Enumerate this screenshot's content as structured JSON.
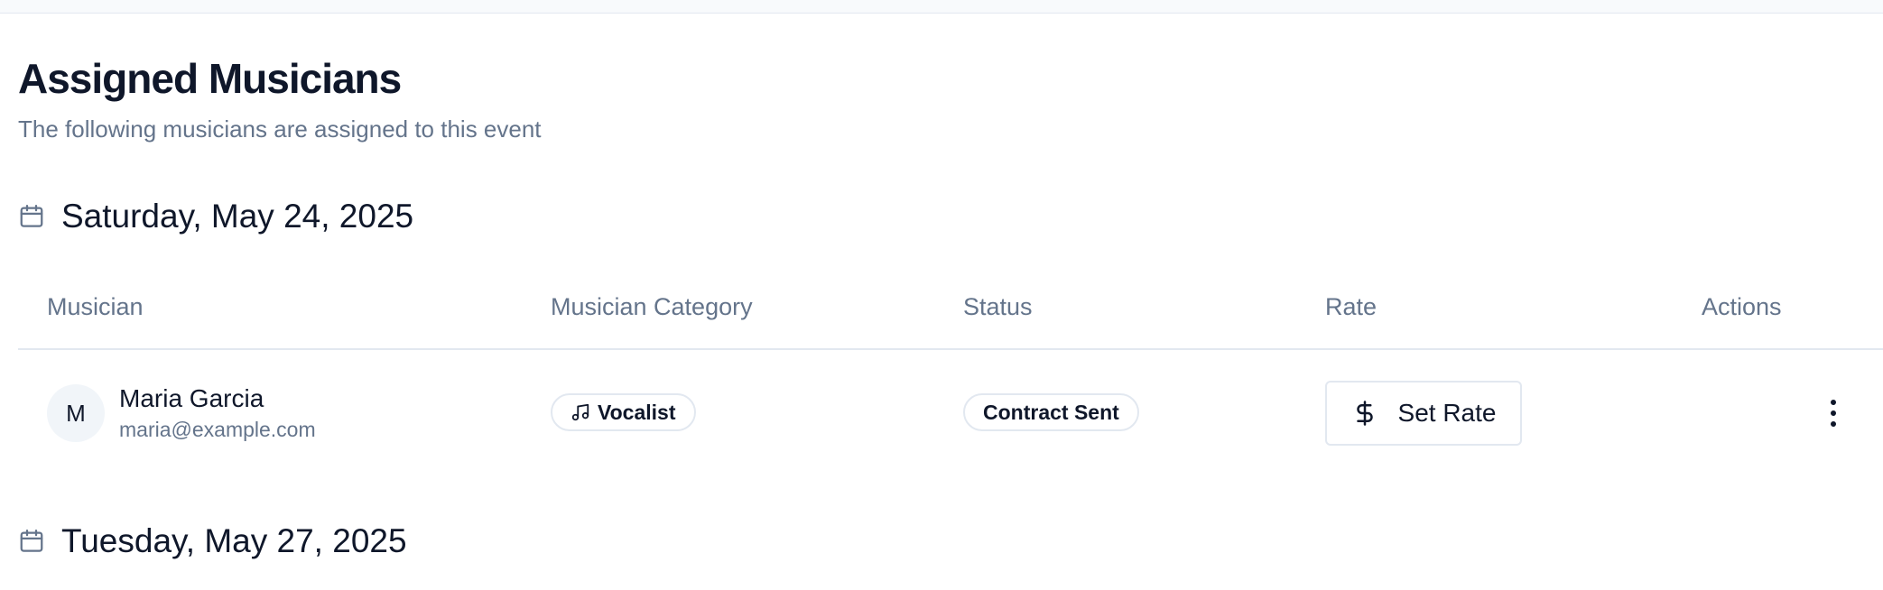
{
  "header": {
    "title": "Assigned Musicians",
    "subtitle": "The following musicians are assigned to this event"
  },
  "table": {
    "columns": [
      "Musician",
      "Musician Category",
      "Status",
      "Rate",
      "Actions"
    ]
  },
  "dates": [
    {
      "label": "Saturday, May 24, 2025",
      "icon": "calendar-icon",
      "rows": [
        {
          "avatar_initial": "M",
          "name": "Maria Garcia",
          "email": "maria@example.com",
          "category": "Vocalist",
          "category_icon": "music-note-icon",
          "status": "Contract Sent",
          "rate_button": "Set Rate",
          "rate_icon": "dollar-icon",
          "actions_icon": "more-vertical-icon"
        }
      ]
    },
    {
      "label": "Tuesday, May 27, 2025",
      "icon": "calendar-icon",
      "rows": []
    }
  ],
  "colors": {
    "text": "#0f172a",
    "muted": "#64748b",
    "border": "#e2e8f0",
    "avatar_bg": "#f1f5f9"
  }
}
